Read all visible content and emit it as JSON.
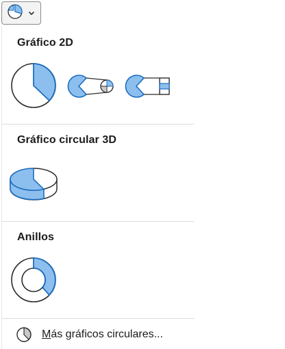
{
  "trigger": {
    "icon": "pie-chart-icon",
    "chevron": "chevron-down-icon"
  },
  "sections": [
    {
      "title": "Gráfico 2D",
      "charts": [
        "pie-chart",
        "pie-of-pie-chart",
        "bar-of-pie-chart"
      ]
    },
    {
      "title": "Gráfico circular 3D",
      "charts": [
        "3d-pie-chart"
      ]
    },
    {
      "title": "Anillos",
      "charts": [
        "doughnut-chart"
      ]
    }
  ],
  "more": {
    "accel": "M",
    "rest": "ás gráficos circulares...",
    "icon": "pie-chart-outline-icon"
  },
  "colors": {
    "accent_fill": "#8dbfee",
    "accent_stroke": "#1b6ec2",
    "outline": "#2b2b2b",
    "white_fill": "#ffffff",
    "separator": "#dcdcdc"
  }
}
